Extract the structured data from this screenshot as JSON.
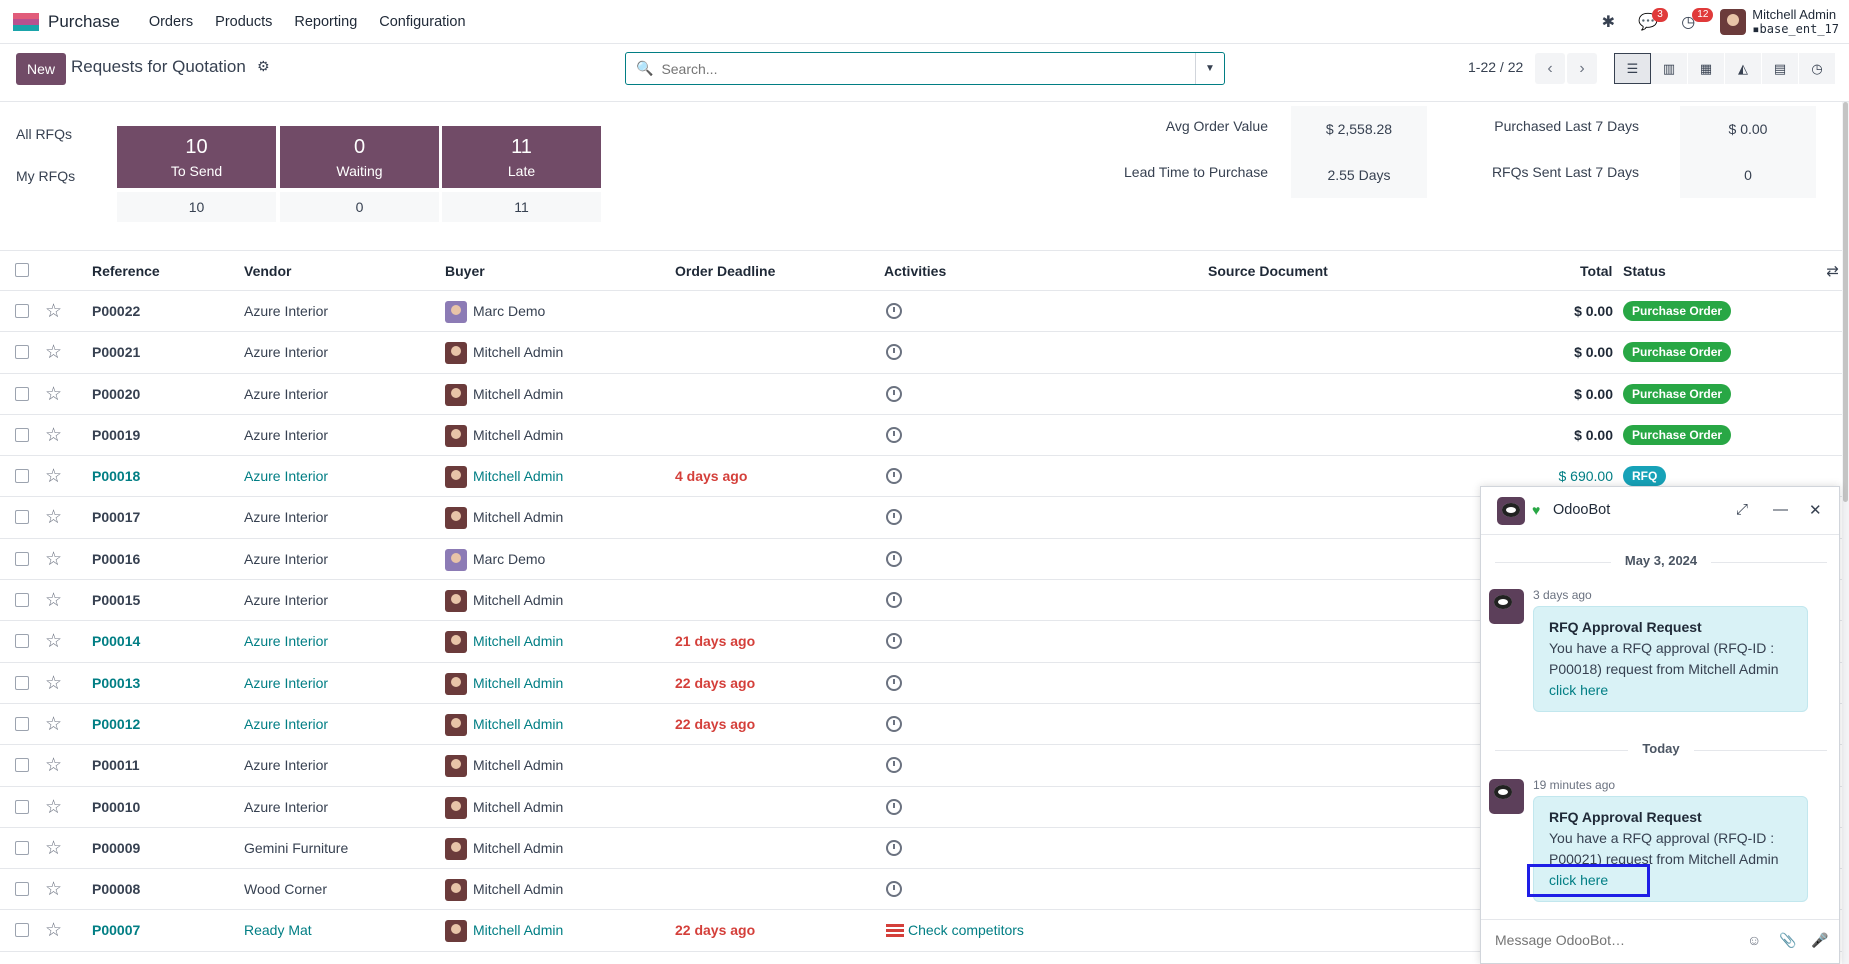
{
  "navbar": {
    "app_name": "Purchase",
    "logo_colors": [
      "#e15c7a",
      "#b8518f",
      "#1ba4aa"
    ],
    "menu": [
      "Orders",
      "Products",
      "Reporting",
      "Configuration"
    ],
    "messages_badge": "3",
    "activities_badge": "12",
    "user_name": "Mitchell Admin",
    "user_db": "base_ent_17"
  },
  "control_panel": {
    "new_label": "New",
    "title": "Requests for Quotation",
    "search_placeholder": "Search...",
    "pager": "1-22 / 22",
    "views": [
      "list",
      "kanban",
      "pivot",
      "graph",
      "calendar",
      "activity"
    ],
    "active_view": "list"
  },
  "dashboard": {
    "all_rfqs_label": "All RFQs",
    "my_rfqs_label": "My RFQs",
    "tiles": [
      {
        "num": "10",
        "label": "To Send",
        "mine": "10"
      },
      {
        "num": "0",
        "label": "Waiting",
        "mine": "0"
      },
      {
        "num": "11",
        "label": "Late",
        "mine": "11"
      }
    ],
    "stats": {
      "avg_order_label": "Avg Order Value",
      "avg_order_value": "$ 2,558.28",
      "purchased_label": "Purchased Last 7 Days",
      "purchased_value": "$ 0.00",
      "lead_time_label": "Lead Time to Purchase",
      "lead_time_value": "2.55 Days",
      "rfqs_sent_label": "RFQs Sent Last 7 Days",
      "rfqs_sent_value": "0"
    }
  },
  "table": {
    "columns": {
      "reference": "Reference",
      "vendor": "Vendor",
      "buyer": "Buyer",
      "deadline": "Order Deadline",
      "activities": "Activities",
      "source": "Source Document",
      "total": "Total",
      "status": "Status"
    },
    "rows": [
      {
        "ref": "P00022",
        "vendor": "Azure Interior",
        "buyer": "Marc Demo",
        "deadline": "",
        "total": "$ 0.00",
        "status": "Purchase Order",
        "hl": false
      },
      {
        "ref": "P00021",
        "vendor": "Azure Interior",
        "buyer": "Mitchell Admin",
        "deadline": "",
        "total": "$ 0.00",
        "status": "Purchase Order",
        "hl": false
      },
      {
        "ref": "P00020",
        "vendor": "Azure Interior",
        "buyer": "Mitchell Admin",
        "deadline": "",
        "total": "$ 0.00",
        "status": "Purchase Order",
        "hl": false
      },
      {
        "ref": "P00019",
        "vendor": "Azure Interior",
        "buyer": "Mitchell Admin",
        "deadline": "",
        "total": "$ 0.00",
        "status": "Purchase Order",
        "hl": false
      },
      {
        "ref": "P00018",
        "vendor": "Azure Interior",
        "buyer": "Mitchell Admin",
        "deadline": "4 days ago",
        "total": "$ 690.00",
        "status": "RFQ",
        "hl": true
      },
      {
        "ref": "P00017",
        "vendor": "Azure Interior",
        "buyer": "Mitchell Admin",
        "deadline": "",
        "total": "",
        "status": "",
        "hl": false
      },
      {
        "ref": "P00016",
        "vendor": "Azure Interior",
        "buyer": "Marc Demo",
        "deadline": "",
        "total": "",
        "status": "",
        "hl": false
      },
      {
        "ref": "P00015",
        "vendor": "Azure Interior",
        "buyer": "Mitchell Admin",
        "deadline": "",
        "total": "",
        "status": "",
        "hl": false
      },
      {
        "ref": "P00014",
        "vendor": "Azure Interior",
        "buyer": "Mitchell Admin",
        "deadline": "21 days ago",
        "total": "",
        "status": "",
        "hl": true
      },
      {
        "ref": "P00013",
        "vendor": "Azure Interior",
        "buyer": "Mitchell Admin",
        "deadline": "22 days ago",
        "total": "",
        "status": "",
        "hl": true
      },
      {
        "ref": "P00012",
        "vendor": "Azure Interior",
        "buyer": "Mitchell Admin",
        "deadline": "22 days ago",
        "total": "",
        "status": "",
        "hl": true
      },
      {
        "ref": "P00011",
        "vendor": "Azure Interior",
        "buyer": "Mitchell Admin",
        "deadline": "",
        "total": "",
        "status": "",
        "hl": false
      },
      {
        "ref": "P00010",
        "vendor": "Azure Interior",
        "buyer": "Mitchell Admin",
        "deadline": "",
        "total": "",
        "status": "",
        "hl": false
      },
      {
        "ref": "P00009",
        "vendor": "Gemini Furniture",
        "buyer": "Mitchell Admin",
        "deadline": "",
        "total": "",
        "status": "",
        "hl": false
      },
      {
        "ref": "P00008",
        "vendor": "Wood Corner",
        "buyer": "Mitchell Admin",
        "deadline": "",
        "total": "",
        "status": "",
        "hl": false
      },
      {
        "ref": "P00007",
        "vendor": "Ready Mat",
        "buyer": "Mitchell Admin",
        "deadline": "22 days ago",
        "total": "",
        "status": "",
        "hl": true,
        "activity_text": "Check competitors"
      }
    ]
  },
  "chat": {
    "name": "OdooBot",
    "day1": "May 3, 2024",
    "msg1_time": "3 days ago",
    "msg1_title": "RFQ Approval Request",
    "msg1_body": "You have a RFQ approval (RFQ-ID : P00018) request from Mitchell Admin",
    "msg1_link": "click here",
    "day2": "Today",
    "msg2_time": "19 minutes ago",
    "msg2_title": "RFQ Approval Request",
    "msg2_body": "You have a RFQ approval (RFQ-ID : P00021) request from Mitchell Admin",
    "msg2_link": "click here",
    "composer_placeholder": "Message OdooBot…"
  }
}
